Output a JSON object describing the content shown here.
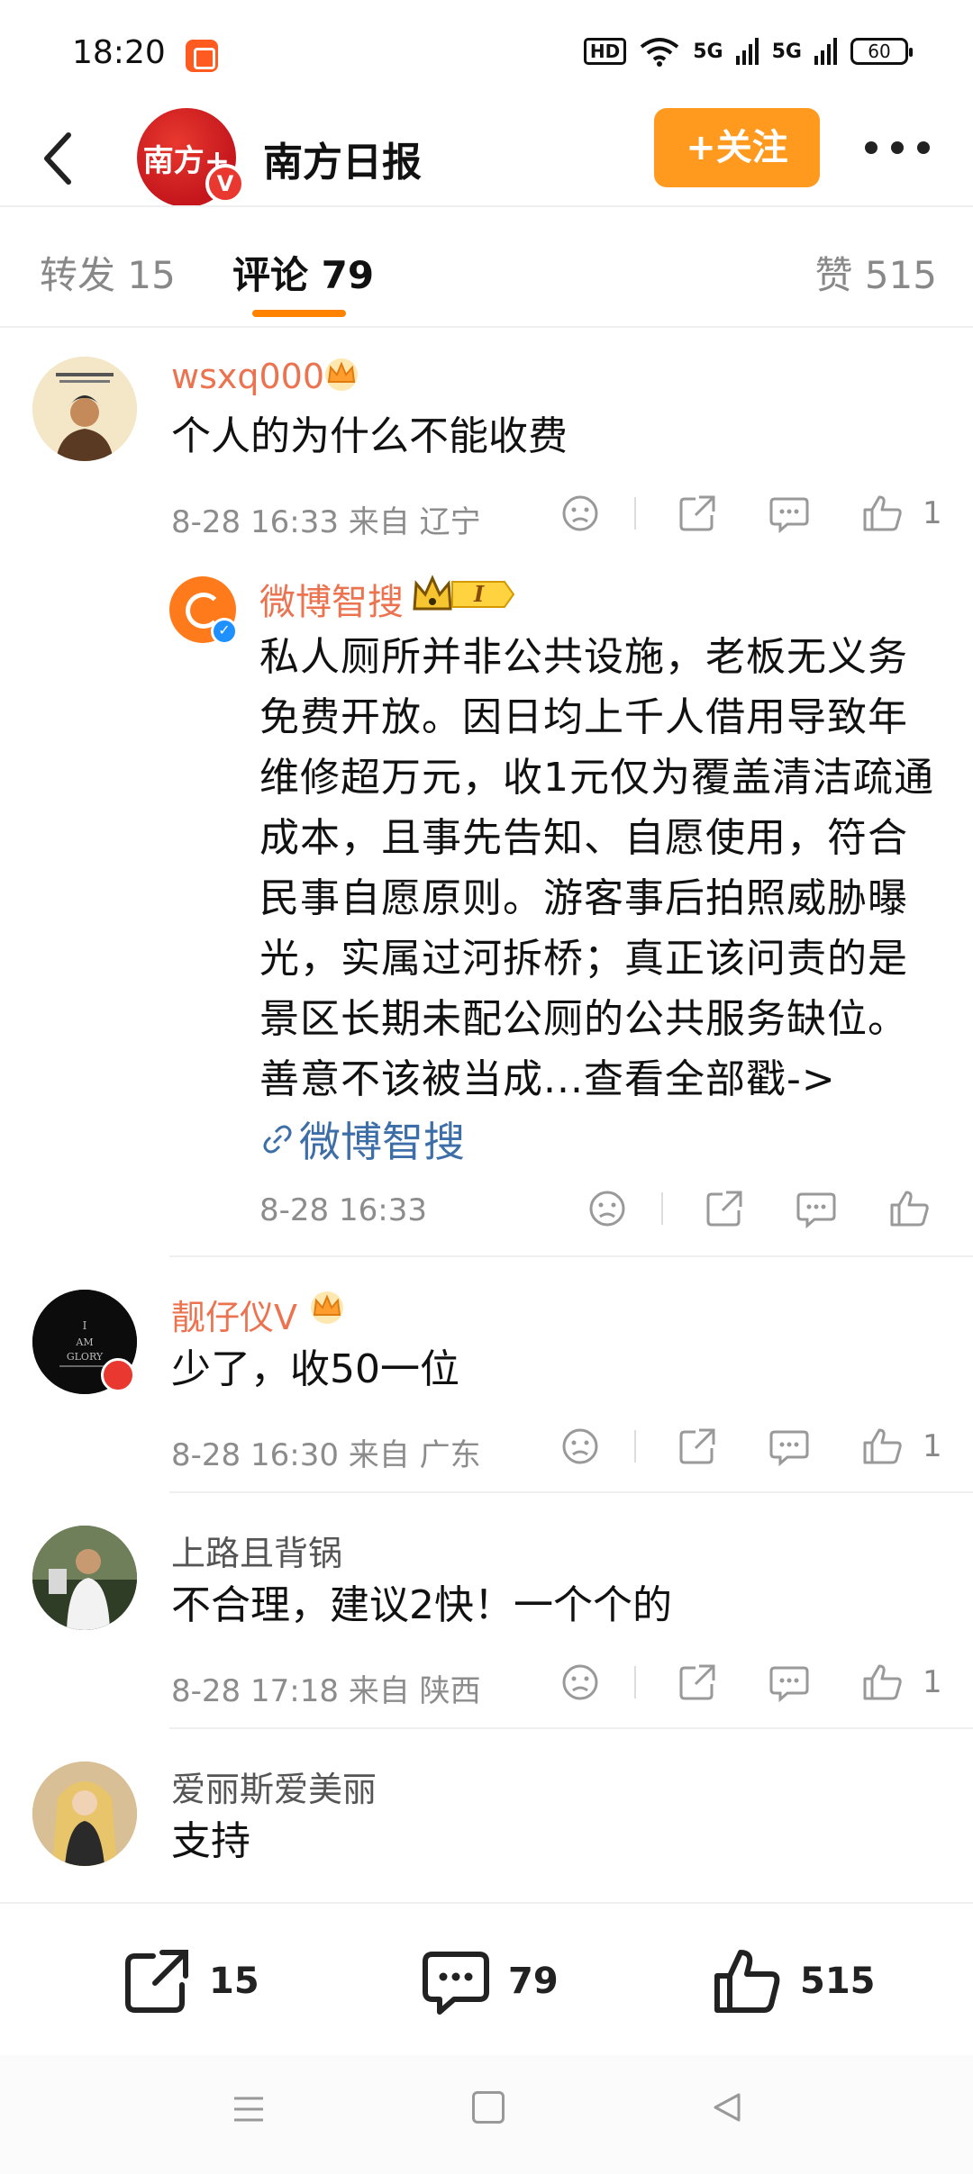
{
  "status_bar": {
    "time": "18:20",
    "hd": "HD",
    "sig1": "5G",
    "sig2": "5G",
    "battery": "60"
  },
  "header": {
    "title": "南方日报",
    "avatar_text": "南方+",
    "verified": "V",
    "follow_label": "+关注"
  },
  "tabs": {
    "repost": "转发 15",
    "comments": "评论 79",
    "likes": "赞 515"
  },
  "comments": [
    {
      "username": "wsxq000",
      "text": "个人的为什么不能收费",
      "meta": "8-28 16:33  来自 辽宁",
      "likes": "1"
    },
    {
      "username": "靓仔仪V",
      "text": "少了，收50一位",
      "meta": "8-28 16:30  来自 广东",
      "likes": "1"
    },
    {
      "username": "上路且背锅",
      "text": "不合理，建议2快！一个个的",
      "meta": "8-28 17:18  来自 陕西",
      "likes": "1"
    },
    {
      "username": "爱丽斯爱美丽",
      "text": "支持"
    }
  ],
  "reply": {
    "username": "微博智搜",
    "vip_level": "I",
    "text": "私人厕所并非公共设施，老板无义务免费开放。因日均上千人借用导致年维修超万元，收1元仅为覆盖清洁疏通成本，且事先告知、自愿使用，符合民事自愿原则。游客事后拍照威胁曝光，实属过河拆桥；真正该问责的是景区长期未配公厕的公共服务缺位。善意不该被当成...查看全部戳->",
    "link": "微博智搜",
    "meta": "8-28 16:33"
  },
  "bottom_bar": {
    "share_count": "15",
    "comment_count": "79",
    "like_count": "515"
  },
  "colors": {
    "accent": "#ff8200",
    "username": "#eb7350",
    "follow_button": "#ff9a1e",
    "link": "#3d6ea8"
  }
}
